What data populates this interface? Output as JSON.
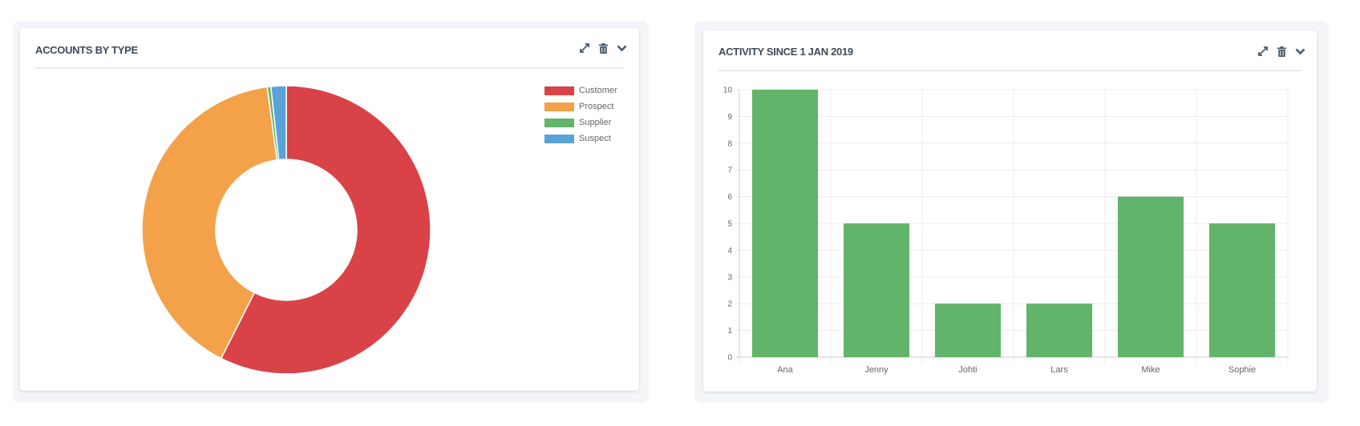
{
  "colors": {
    "customer": "#d94247",
    "prospect": "#f3a24a",
    "supplier": "#62b46a",
    "suspect": "#5aa3d9",
    "bar": "#62b46a",
    "title": "#3f4b58",
    "icon": "#4c5a6a"
  },
  "widgets": [
    {
      "title": "ACCOUNTS BY TYPE",
      "icons": [
        "expand-icon",
        "trash-icon",
        "chevron-down-icon"
      ]
    },
    {
      "title": "ACTIVITY SINCE 1 JAN 2019",
      "icons": [
        "expand-icon",
        "trash-icon",
        "chevron-down-icon"
      ]
    }
  ],
  "chart_data": [
    {
      "type": "pie",
      "variant": "doughnut",
      "title": "ACCOUNTS BY TYPE",
      "categories": [
        "Customer",
        "Prospect",
        "Supplier",
        "Suspect"
      ],
      "values": [
        57.4,
        40.4,
        0.4,
        1.7
      ],
      "value_units": "approx. percent of total (estimated from slice angles)",
      "legend_position": "top-right",
      "draw_order_note": "clockwise from top: Customer, Prospect, Supplier, Suspect"
    },
    {
      "type": "bar",
      "title": "ACTIVITY SINCE 1 JAN 2019",
      "categories": [
        "Ana",
        "Jenny",
        "Johti",
        "Lars",
        "Mike",
        "Sophie"
      ],
      "values": [
        10,
        5,
        2,
        2,
        6,
        5
      ],
      "xlabel": "",
      "ylabel": "",
      "ylim": [
        0,
        10
      ],
      "yticks": [
        0,
        1,
        2,
        3,
        4,
        5,
        6,
        7,
        8,
        9,
        10
      ],
      "grid": true,
      "legend_position": "none"
    }
  ]
}
